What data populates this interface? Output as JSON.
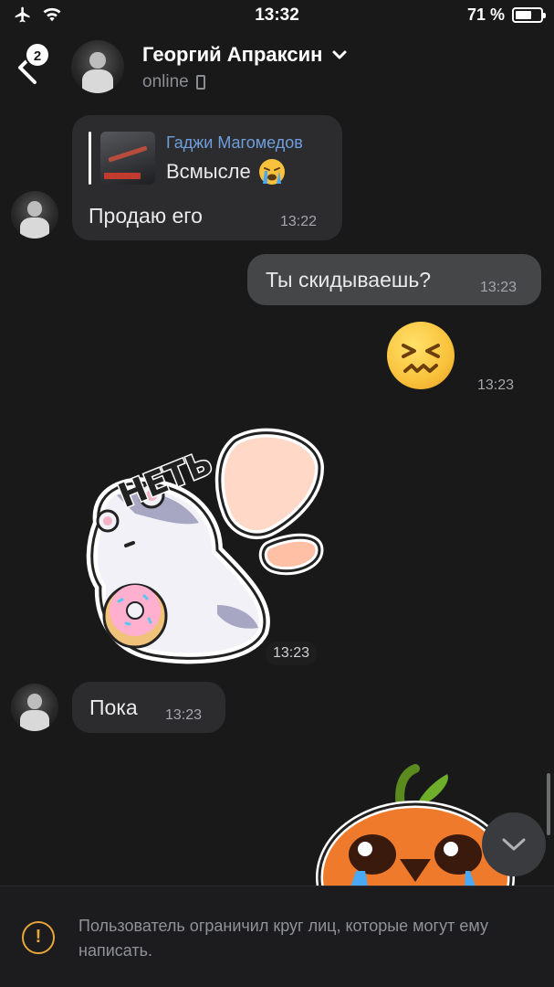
{
  "status_bar": {
    "time": "13:32",
    "battery": "71 %",
    "battery_level": 0.71
  },
  "header": {
    "name": "Георгий Апраксин",
    "status": "online",
    "unread_count": "2"
  },
  "messages": [
    {
      "reply_author": "Гаджи Магомедов",
      "reply_text": "Всмысле",
      "text": "Продаю его",
      "time": "13:22"
    },
    {
      "text": "Ты скидываешь?",
      "time": "13:23"
    },
    {
      "time": "13:23"
    },
    {
      "sticker_text": "НЕТЬ",
      "time": "13:23"
    },
    {
      "text": "Пока",
      "time": "13:23"
    }
  ],
  "notice": {
    "text": "Пользователь ограничил круг лиц, которые могут ему написать."
  },
  "colors": {
    "background": "#19191a",
    "incoming_bubble": "#2c2c2e",
    "outgoing_bubble": "#454648",
    "reply_author": "#6e9fdc",
    "warning": "#e8a53a"
  }
}
